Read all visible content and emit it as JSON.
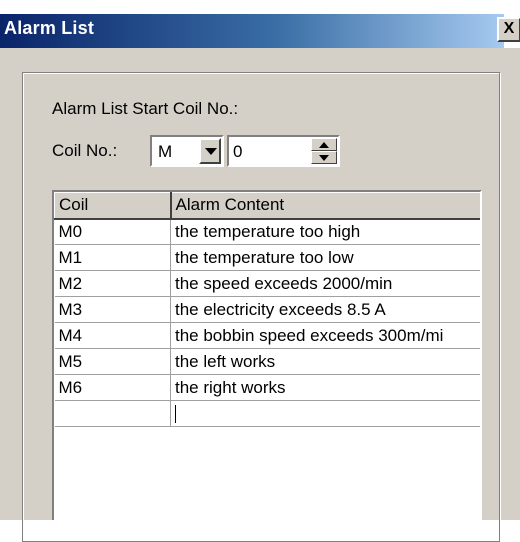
{
  "window": {
    "title": "Alarm List",
    "close_label": "X"
  },
  "form": {
    "section_label": "Alarm List Start Coil No.:",
    "coil_label": "Coil No.:",
    "coil_type": "M",
    "coil_number": "0"
  },
  "table": {
    "headers": [
      "Coil",
      "Alarm Content"
    ],
    "rows": [
      [
        "M0",
        "the temperature too high"
      ],
      [
        "M1",
        "the temperature too low"
      ],
      [
        "M2",
        "the speed exceeds 2000/min"
      ],
      [
        "M3",
        "the electricity exceeds 8.5 A"
      ],
      [
        "M4",
        "the bobbin speed exceeds 300m/mi"
      ],
      [
        "M5",
        "the left works"
      ],
      [
        "M6",
        "the right works"
      ],
      [
        "",
        ""
      ]
    ]
  }
}
